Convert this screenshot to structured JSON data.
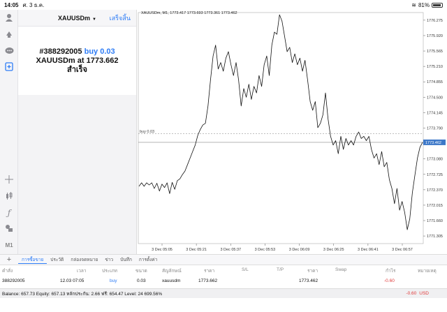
{
  "status": {
    "time": "14:05",
    "date": "ศ. 3 ธ.ค.",
    "battery": "81%"
  },
  "rail": {
    "m1_label": "M1"
  },
  "order": {
    "symbol": "XAUUSDm",
    "done_label": "เสร็จสิ้น",
    "ticket": "#388292005",
    "side_size": "buy 0.03",
    "line2_prefix": "XAUUSDm at",
    "price": "1773.662",
    "status": "สำเร็จ"
  },
  "chart": {
    "title": "XAUUSDm, M1, 1773.417 1773.693 1773.361 1773.462",
    "order_line_label": "buy 0.03",
    "current_price_label": "1773.462"
  },
  "chart_data": {
    "type": "line",
    "title": "XAUUSDm, M1, 1773.417 1773.693 1773.361 1773.462",
    "x_ticks": [
      "3 Dec 05:05",
      "3 Dec 05:21",
      "3 Dec 05:37",
      "3 Dec 05:53",
      "3 Dec 06:09",
      "3 Dec 06:25",
      "3 Dec 06:41",
      "3 Dec 06:57"
    ],
    "y_ticks": [
      1776.275,
      1775.92,
      1775.565,
      1775.21,
      1774.855,
      1774.5,
      1774.145,
      1773.79,
      1773.435,
      1773.08,
      1772.725,
      1772.37,
      1772.015,
      1771.66,
      1771.305
    ],
    "ylim": [
      1771.13,
      1776.45
    ],
    "order_line": 1773.662,
    "current_price": 1773.462,
    "series": [
      {
        "values": [
          1772.45,
          1772.53,
          1772.45,
          1772.53,
          1772.48,
          1772.53,
          1772.4,
          1772.52,
          1772.34,
          1772.5,
          1772.42,
          1772.53,
          1772.28,
          1772.54,
          1772.38,
          1772.58,
          1772.62,
          1772.72,
          1772.8,
          1772.95,
          1773.1,
          1773.25,
          1773.4,
          1773.62,
          1773.76,
          1773.86,
          1773.9,
          1774.3,
          1774.9,
          1775.45,
          1775.7,
          1775.15,
          1775.3,
          1775.1,
          1775.4,
          1775.55,
          1775.25,
          1775.0,
          1775.3,
          1774.9,
          1774.3,
          1774.7,
          1774.5,
          1774.8,
          1774.45,
          1774.75,
          1774.6,
          1775.0,
          1774.75,
          1775.25,
          1775.45,
          1775.0,
          1775.7,
          1776.0,
          1775.95,
          1776.4,
          1776.25,
          1775.9,
          1775.55,
          1775.65,
          1775.3,
          1775.5,
          1775.25,
          1775.4,
          1775.1,
          1775.35,
          1774.9,
          1774.4,
          1774.2,
          1774.4,
          1773.8,
          1773.9,
          1774.1,
          1774.6,
          1774.0,
          1773.6,
          1773.4,
          1773.5,
          1773.2,
          1773.6,
          1773.3,
          1773.55,
          1773.4,
          1773.5,
          1773.4,
          1773.6,
          1773.7,
          1773.55,
          1773.6,
          1773.5,
          1773.6,
          1773.3,
          1773.1,
          1773.2,
          1772.95,
          1773.25,
          1772.9,
          1773.0,
          1772.6,
          1772.4,
          1772.05,
          1772.4,
          1771.9,
          1772.1,
          1771.85,
          1771.45,
          1771.7,
          1772.3,
          1772.7,
          1773.1,
          1773.35,
          1773.462
        ]
      }
    ]
  },
  "tabs": [
    "การซื้อขาย",
    "ประวัติ",
    "กล่องจดหมาย",
    "ข่าว",
    "บันทึก",
    "การตั้งค่า"
  ],
  "columns": [
    "คำสั่ง",
    "เวลา",
    "ประเภท",
    "ขนาด",
    "สัญลักษณ์",
    "ราคา",
    "S/L",
    "T/P",
    "ราคา",
    "Swap",
    "กำไร",
    "หมายเหตุ"
  ],
  "position": {
    "ticket": "388292005",
    "time": "12.03 07:05",
    "type": "buy",
    "size": "0.03",
    "symbol": "xauusdm",
    "open_price": "1773.662",
    "current_price": "1773.462",
    "profit": "-0.60"
  },
  "account": {
    "summary": "Balance: 657.73 Equity: 657.13 หลักประกัน: 2.66 ฟรี: 654.47 Level: 24 699.56%",
    "pl": "-0.60",
    "currency": "USD"
  },
  "colors": {
    "accent": "#2d7cf6",
    "loss": "#e03a3a",
    "line": "#111111"
  }
}
